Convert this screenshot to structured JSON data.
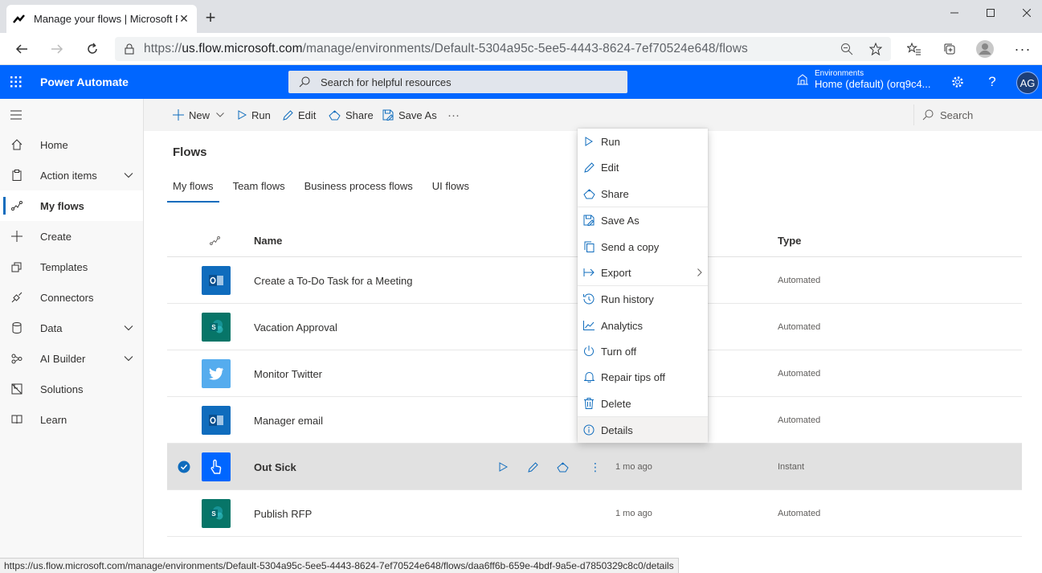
{
  "browser": {
    "tab_title": "Manage your flows | Microsoft Power Automate",
    "url_scheme": "https://",
    "url_host": "us.flow.microsoft.com",
    "url_path": "/manage/environments/Default-5304a95c-5ee5-4443-8624-7ef70524e648/flows",
    "status_url": "https://us.flow.microsoft.com/manage/environments/Default-5304a95c-5ee5-4443-8624-7ef70524e648/flows/daa6ff6b-659e-4bdf-9a5e-d7850329c8c0/details"
  },
  "header": {
    "app_name": "Power Automate",
    "search_placeholder": "Search for helpful resources",
    "env_label": "Environments",
    "env_name": "Home (default) (orq9c4...",
    "avatar_initials": "AG",
    "brand_color": "#0066ff"
  },
  "sidebar": {
    "items": [
      {
        "label": "Home",
        "icon": "home-icon"
      },
      {
        "label": "Action items",
        "icon": "clipboard-icon",
        "expandable": true
      },
      {
        "label": "My flows",
        "icon": "flow-icon",
        "active": true
      },
      {
        "label": "Create",
        "icon": "plus-icon"
      },
      {
        "label": "Templates",
        "icon": "templates-icon"
      },
      {
        "label": "Connectors",
        "icon": "connector-icon"
      },
      {
        "label": "Data",
        "icon": "database-icon",
        "expandable": true
      },
      {
        "label": "AI Builder",
        "icon": "ai-icon",
        "expandable": true
      },
      {
        "label": "Solutions",
        "icon": "solutions-icon"
      },
      {
        "label": "Learn",
        "icon": "book-icon"
      }
    ]
  },
  "commandbar": {
    "new": "New",
    "run": "Run",
    "edit": "Edit",
    "share": "Share",
    "save_as": "Save As",
    "more": "···",
    "search": "Search"
  },
  "main": {
    "title": "Flows",
    "tabs": [
      "My flows",
      "Team flows",
      "Business process flows",
      "UI flows"
    ],
    "columns": {
      "name": "Name",
      "type": "Type"
    },
    "rows": [
      {
        "name": "Create a To-Do Task for a Meeting",
        "modified": "",
        "type": "Automated",
        "icon": "outlook-icon"
      },
      {
        "name": "Vacation Approval",
        "modified": "",
        "type": "Automated",
        "icon": "sharepoint-icon"
      },
      {
        "name": "Monitor Twitter",
        "modified": "",
        "type": "Automated",
        "icon": "twitter-icon"
      },
      {
        "name": "Manager email",
        "modified": "",
        "type": "Automated",
        "icon": "outlook-icon"
      },
      {
        "name": "Out Sick",
        "modified": "1 mo ago",
        "type": "Instant",
        "icon": "touch-icon",
        "selected": true
      },
      {
        "name": "Publish RFP",
        "modified": "1 mo ago",
        "type": "Automated",
        "icon": "sharepoint-icon"
      }
    ]
  },
  "context_menu": {
    "items": [
      "Run",
      "Edit",
      "Share",
      "Save As",
      "Send a copy",
      "Export",
      "Run history",
      "Analytics",
      "Turn off",
      "Repair tips off",
      "Delete",
      "Details"
    ]
  },
  "colors": {
    "outlook": "#0f6cbd",
    "sharepoint": "#077568",
    "twitter": "#55acee",
    "button": "#0066ff"
  }
}
